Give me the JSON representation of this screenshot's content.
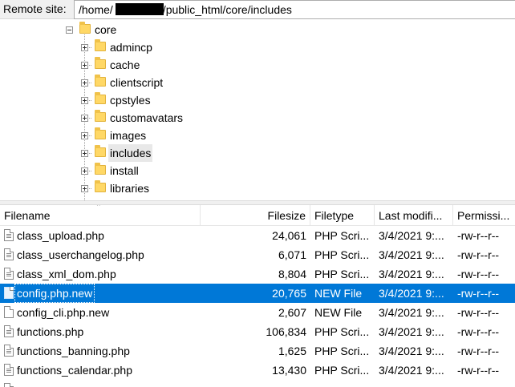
{
  "remote_site": {
    "label": "Remote site:",
    "path_prefix": "/home/",
    "path_suffix": "/public_html/core/includes"
  },
  "tree": {
    "root": {
      "label": "core",
      "expanded": true
    },
    "children": [
      {
        "label": "admincp",
        "expanded": false,
        "selected": false
      },
      {
        "label": "cache",
        "expanded": false,
        "selected": false
      },
      {
        "label": "clientscript",
        "expanded": false,
        "selected": false
      },
      {
        "label": "cpstyles",
        "expanded": false,
        "selected": false
      },
      {
        "label": "customavatars",
        "expanded": false,
        "selected": false
      },
      {
        "label": "images",
        "expanded": false,
        "selected": false
      },
      {
        "label": "includes",
        "expanded": false,
        "selected": true
      },
      {
        "label": "install",
        "expanded": false,
        "selected": false
      },
      {
        "label": "libraries",
        "expanded": false,
        "selected": false
      }
    ]
  },
  "file_list": {
    "columns": {
      "filename": "Filename",
      "filesize": "Filesize",
      "filetype": "Filetype",
      "modified": "Last modifi...",
      "permissions": "Permissi..."
    },
    "rows": [
      {
        "name": "class_upload.php",
        "size": "24,061",
        "type": "PHP Scri...",
        "modified": "3/4/2021 9:...",
        "perms": "-rw-r--r--",
        "icon": "php-file-icon",
        "selected": false
      },
      {
        "name": "class_userchangelog.php",
        "size": "6,071",
        "type": "PHP Scri...",
        "modified": "3/4/2021 9:...",
        "perms": "-rw-r--r--",
        "icon": "php-file-icon",
        "selected": false
      },
      {
        "name": "class_xml_dom.php",
        "size": "8,804",
        "type": "PHP Scri...",
        "modified": "3/4/2021 9:...",
        "perms": "-rw-r--r--",
        "icon": "php-file-icon",
        "selected": false
      },
      {
        "name": "config.php.new",
        "size": "20,765",
        "type": "NEW File",
        "modified": "3/4/2021 9:...",
        "perms": "-rw-r--r--",
        "icon": "blank-file-icon",
        "selected": true
      },
      {
        "name": "config_cli.php.new",
        "size": "2,607",
        "type": "NEW File",
        "modified": "3/4/2021 9:...",
        "perms": "-rw-r--r--",
        "icon": "blank-file-icon",
        "selected": false
      },
      {
        "name": "functions.php",
        "size": "106,834",
        "type": "PHP Scri...",
        "modified": "3/4/2021 9:...",
        "perms": "-rw-r--r--",
        "icon": "php-file-icon",
        "selected": false
      },
      {
        "name": "functions_banning.php",
        "size": "1,625",
        "type": "PHP Scri...",
        "modified": "3/4/2021 9:...",
        "perms": "-rw-r--r--",
        "icon": "php-file-icon",
        "selected": false
      },
      {
        "name": "functions_calendar.php",
        "size": "13,430",
        "type": "PHP Scri...",
        "modified": "3/4/2021 9:...",
        "perms": "-rw-r--r--",
        "icon": "php-file-icon",
        "selected": false
      },
      {
        "name": "",
        "size": "",
        "type": "",
        "modified": "",
        "perms": "",
        "icon": "php-file-icon",
        "selected": false
      }
    ]
  },
  "colors": {
    "selection": "#0078d7",
    "folder": "#ffd866",
    "tree_selected_bg": "#e8e8e8"
  }
}
